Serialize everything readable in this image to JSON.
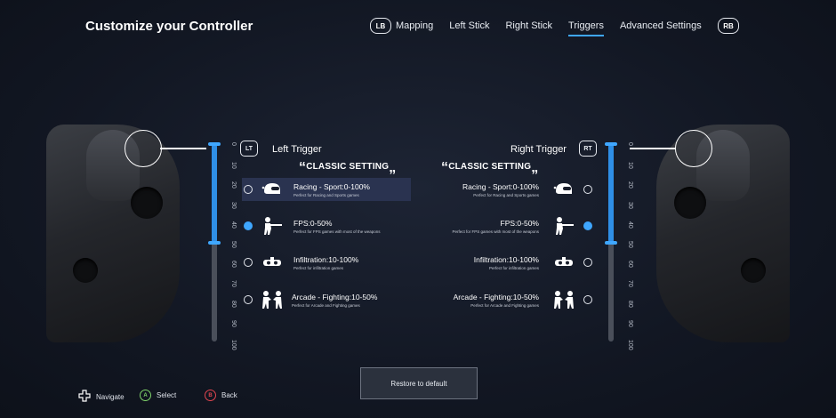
{
  "header": {
    "title": "Customize your Controller",
    "lb": "LB",
    "rb": "RB",
    "tabs": [
      "Mapping",
      "Left Stick",
      "Right Stick",
      "Triggers",
      "Advanced Settings"
    ],
    "active_tab": "Triggers"
  },
  "left": {
    "label": "Left Trigger",
    "badge": "LT",
    "range_pct": [
      0,
      50
    ]
  },
  "right": {
    "label": "Right Trigger",
    "badge": "RT",
    "range_pct": [
      0,
      50
    ]
  },
  "scale_ticks": [
    "0",
    "10",
    "20",
    "30",
    "40",
    "50",
    "60",
    "70",
    "80",
    "90",
    "100"
  ],
  "preset_heading": "CLASSIC SETTING",
  "quote_open": "“",
  "quote_close": "„",
  "presets": [
    {
      "title": "Racing - Sport:0-100%",
      "desc": "Perfect for Racing and Sports games",
      "icon": "helmet-icon"
    },
    {
      "title": "FPS:0-50%",
      "desc": "Perfect for FPS games with most of the weapons",
      "icon": "gunner-icon"
    },
    {
      "title": "Infiltration:10-100%",
      "desc": "Perfect for infiltration games",
      "icon": "goggles-icon"
    },
    {
      "title": "Arcade - Fighting:10-50%",
      "desc": "Perfect for Arcade and Fighting games",
      "icon": "fighters-icon"
    }
  ],
  "selected_preset": "FPS:0-50%",
  "restore_label": "Restore to default",
  "hints": {
    "navigate": "Navigate",
    "select": "Select",
    "select_btn": "A",
    "back": "Back",
    "back_btn": "B"
  },
  "colors": {
    "accent": "#3fa7ff",
    "select_green": "#7fd36b",
    "back_red": "#e0454f"
  }
}
